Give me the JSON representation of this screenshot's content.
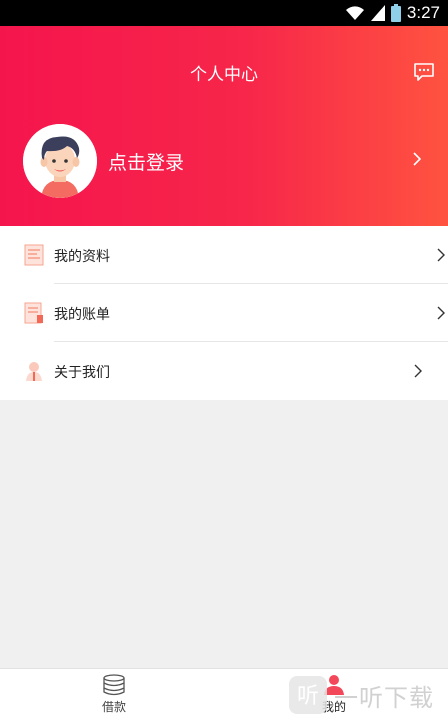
{
  "status_bar": {
    "time": "3:27"
  },
  "header": {
    "title": "个人中心",
    "login_text": "点击登录"
  },
  "menu": {
    "items": [
      {
        "label": "我的资料",
        "icon": "profile-doc-icon"
      },
      {
        "label": "我的账单",
        "icon": "bill-doc-icon"
      },
      {
        "label": "关于我们",
        "icon": "about-person-icon"
      }
    ]
  },
  "tabbar": {
    "tabs": [
      {
        "label": "借款",
        "icon": "coins-stack-icon"
      },
      {
        "label": "我的",
        "icon": "user-icon"
      }
    ]
  },
  "watermark": {
    "text": "一听下载",
    "logo_text": "听"
  },
  "colors": {
    "header_start": "#f5154d",
    "header_end": "#ff5340",
    "accent": "#f7264a"
  }
}
